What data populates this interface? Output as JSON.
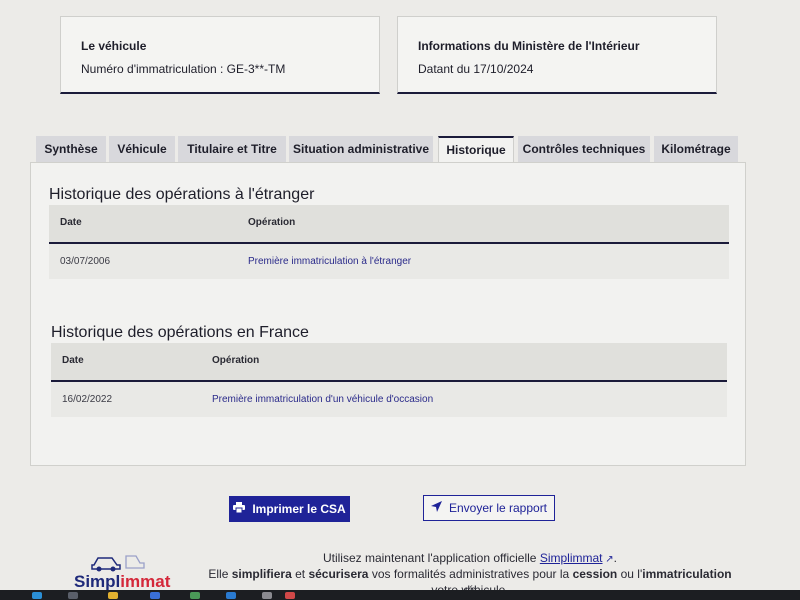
{
  "vehicle_card": {
    "title": "Le véhicule",
    "plate_text": "Numéro d'immatriculation : GE-3**-TM"
  },
  "ministry_card": {
    "title": "Informations du Ministère de l'Intérieur",
    "date_text": "Datant du 17/10/2024"
  },
  "tabs": [
    {
      "label": "Synthèse",
      "active": false
    },
    {
      "label": "Véhicule",
      "active": false
    },
    {
      "label": "Titulaire et Titre",
      "active": false
    },
    {
      "label": "Situation administrative",
      "active": false
    },
    {
      "label": "Historique",
      "active": true
    },
    {
      "label": "Contrôles techniques",
      "active": false
    },
    {
      "label": "Kilométrage",
      "active": false
    }
  ],
  "history_abroad": {
    "heading": "Historique des opérations à l'étranger",
    "columns": [
      "Date",
      "Opération"
    ],
    "rows": [
      {
        "date": "03/07/2006",
        "operation": "Première immatriculation à l'étranger"
      }
    ]
  },
  "history_france": {
    "heading": "Historique des opérations en France",
    "columns": [
      "Date",
      "Opération"
    ],
    "rows": [
      {
        "date": "16/02/2022",
        "operation": "Première immatriculation d'un véhicule d'occasion"
      }
    ]
  },
  "actions": {
    "print_label": "Imprimer le CSA",
    "send_label": "Envoyer le rapport"
  },
  "footer": {
    "line1_prefix": "Utilisez maintenant l'application officielle ",
    "app_link": "Simplimmat",
    "line1_suffix": ".",
    "line2_a": "Elle ",
    "line2_b": "simplifiera",
    "line2_c": " et ",
    "line2_d": "sécurisera",
    "line2_e": " vos formalités administratives pour la ",
    "line2_f": "cession",
    "line2_g": " ou l'",
    "line2_h": "immatriculation",
    "line2_i": " de",
    "line3": "votre véhicule.",
    "logo_text_a": "Simpl",
    "logo_text_b": "immat"
  },
  "colors": {
    "primary": "#1f2398",
    "accent_red": "#d4283a",
    "tab_inactive": "#d8d8dc"
  }
}
